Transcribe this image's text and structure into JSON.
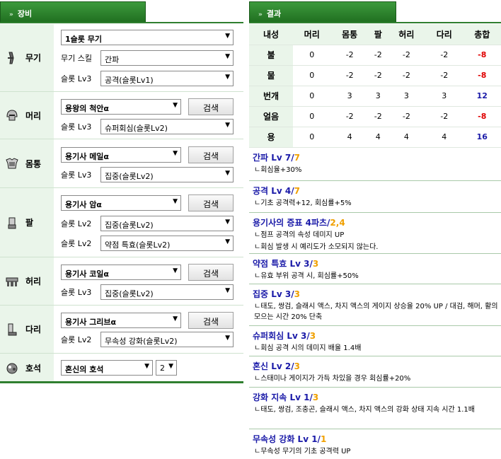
{
  "left_tab": {
    "title": "장비"
  },
  "right_tab": {
    "title": "결과"
  },
  "equipment": {
    "weapon": {
      "label": "무기",
      "main": "1슬롯 무기",
      "sub1_label": "무기 스킬",
      "sub1_value": "간파",
      "sub2_label": "슬롯 Lv3",
      "sub2_value": "공격(슬롯Lv1)"
    },
    "head": {
      "label": "머리",
      "main": "용왕의 척안α",
      "search": "검색",
      "sub1_label": "슬롯 Lv3",
      "sub1_value": "슈퍼회심(슬롯Lv2)"
    },
    "body": {
      "label": "몸통",
      "main": "용기사 메일α",
      "search": "검색",
      "sub1_label": "슬롯 Lv3",
      "sub1_value": "집중(슬롯Lv2)"
    },
    "arms": {
      "label": "팔",
      "main": "용기사 암α",
      "search": "검색",
      "sub1_label": "슬롯 Lv2",
      "sub1_value": "집중(슬롯Lv2)",
      "sub2_label": "슬롯 Lv2",
      "sub2_value": "약점 특효(슬롯Lv2)"
    },
    "waist": {
      "label": "허리",
      "main": "용기사 코일α",
      "search": "검색",
      "sub1_label": "슬롯 Lv3",
      "sub1_value": "집중(슬롯Lv2)"
    },
    "legs": {
      "label": "다리",
      "main": "용기사 그리브α",
      "search": "검색",
      "sub1_label": "슬롯 Lv2",
      "sub1_value": "무속성 강화(슬롯Lv2)"
    },
    "charm": {
      "label": "호석",
      "main": "혼신의 호석",
      "level": "2"
    }
  },
  "results": {
    "headers": [
      "내성",
      "머리",
      "몸통",
      "팔",
      "허리",
      "다리",
      "총합"
    ],
    "rows": [
      {
        "name": "불",
        "vals": [
          "0",
          "-2",
          "-2",
          "-2",
          "-2"
        ],
        "total": "-8"
      },
      {
        "name": "물",
        "vals": [
          "0",
          "-2",
          "-2",
          "-2",
          "-2"
        ],
        "total": "-8"
      },
      {
        "name": "번개",
        "vals": [
          "0",
          "3",
          "3",
          "3",
          "3"
        ],
        "total": "12"
      },
      {
        "name": "얼음",
        "vals": [
          "0",
          "-2",
          "-2",
          "-2",
          "-2"
        ],
        "total": "-8"
      },
      {
        "name": "용",
        "vals": [
          "0",
          "4",
          "4",
          "4",
          "4"
        ],
        "total": "16"
      }
    ]
  },
  "skills": [
    {
      "name": "간파 Lv 7/",
      "max": "7",
      "descs": [
        "ㄴ회심율+30%"
      ]
    },
    {
      "name": "공격 Lv 4/",
      "max": "7",
      "descs": [
        "ㄴ기초 공격력+12, 회심률+5%"
      ]
    },
    {
      "name": "용기사의 증표 4파츠/",
      "max": "2,4",
      "descs": [
        "ㄴ점프 공격의 속성 데미지 UP",
        "ㄴ회심 발생 시 예리도가 소모되지 않는다."
      ]
    },
    {
      "name": "약점 특효 Lv 3/",
      "max": "3",
      "descs": [
        "ㄴ유효 부위 공격 시, 회심률+50%"
      ]
    },
    {
      "name": "집중 Lv 3/",
      "max": "3",
      "descs": [
        "ㄴ태도, 쌍검, 슬래시 액스, 차지 액스의 게이지 상승율 20% UP / 대검, 해머, 활의 모으는 시간 20% 단축"
      ]
    },
    {
      "name": "슈퍼회심 Lv 3/",
      "max": "3",
      "descs": [
        "ㄴ회심 공격 시의 데미지 배율 1.4배"
      ]
    },
    {
      "name": "혼신 Lv 2/",
      "max": "3",
      "descs": [
        "ㄴ스태미나 게이지가 가득 차있을 경우 회심률+20%"
      ]
    },
    {
      "name": "강화 지속 Lv 1/",
      "max": "3",
      "descs": [
        "ㄴ태도, 쌍검, 조충곤, 슬래시 액스, 차지 액스의 강화 상태 지속 시간 1.1배"
      ]
    },
    {
      "name": "무속성 강화 Lv 1/",
      "max": "1",
      "descs": [
        "ㄴ무속성 무기의 기초 공격력 UP"
      ]
    }
  ],
  "colors": {
    "accent": "#2f7f2f",
    "label_bg": "#eaf5ea",
    "negative": "#e00000",
    "positive": "#1a1aa8",
    "max": "#f0a000"
  }
}
